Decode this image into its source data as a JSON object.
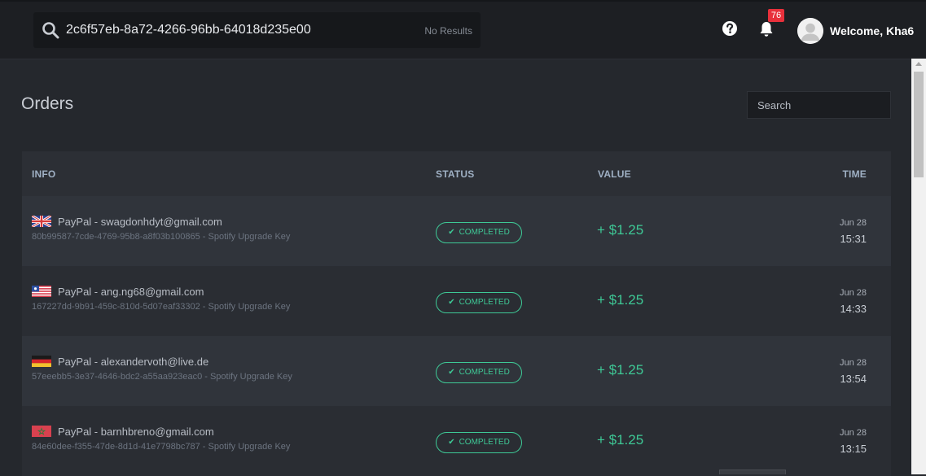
{
  "topbar": {
    "search_query": "2c6f57eb-8a72-4266-96bb-64018d235e00",
    "search_status": "No Results",
    "help_icon": "question-circle-icon",
    "notification_icon": "bell-icon",
    "notification_count": "76",
    "welcome_text": "Welcome, Kha6"
  },
  "page": {
    "title": "Orders",
    "search_placeholder": "Search"
  },
  "table": {
    "headers": {
      "info": "INFO",
      "status": "STATUS",
      "value": "VALUE",
      "time": "TIME"
    },
    "rows": [
      {
        "flag": "uk-flag-icon",
        "title": "PayPal - swagdonhdyt@gmail.com",
        "subtitle": "80b99587-7cde-4769-95b8-a8f03b100865 - Spotify Upgrade Key",
        "status": "COMPLETED",
        "value": "+ $1.25",
        "date": "Jun 28",
        "time": "15:31"
      },
      {
        "flag": "liberia-flag-icon",
        "title": "PayPal - ang.ng68@gmail.com",
        "subtitle": "167227dd-9b91-459c-810d-5d07eaf33302 - Spotify Upgrade Key",
        "status": "COMPLETED",
        "value": "+ $1.25",
        "date": "Jun 28",
        "time": "14:33"
      },
      {
        "flag": "germany-flag-icon",
        "title": "PayPal - alexandervoth@live.de",
        "subtitle": "57eeebb5-3e37-4646-bdc2-a55aa923eac0 - Spotify Upgrade Key",
        "status": "COMPLETED",
        "value": "+ $1.25",
        "date": "Jun 28",
        "time": "13:54"
      },
      {
        "flag": "morocco-flag-icon",
        "title": "PayPal - barnhbreno@gmail.com",
        "subtitle": "84e60dee-f355-47de-8d1d-41e7798bc787 - Spotify Upgrade Key",
        "status": "COMPLETED",
        "value": "+ $1.25",
        "date": "Jun 28",
        "time": "13:15"
      }
    ]
  },
  "colors": {
    "accent_green": "#3ec996",
    "badge_red": "#e8303b",
    "topbar_bg": "#1d1f23",
    "page_bg": "#25282d"
  }
}
